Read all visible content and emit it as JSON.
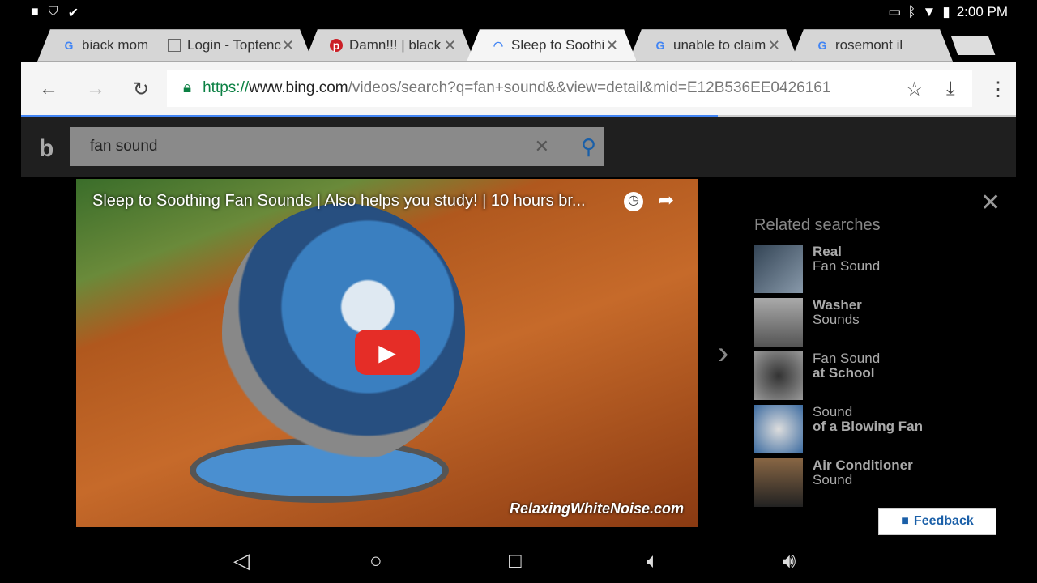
{
  "status": {
    "time": "2:00 PM"
  },
  "tabs": [
    {
      "title": "biack mom",
      "favicon": "google"
    },
    {
      "title": "Login - Toptenc",
      "favicon": "page"
    },
    {
      "title": "Damn!!! | black",
      "favicon": "pinterest"
    },
    {
      "title": "Sleep to Soothi",
      "favicon": "loading",
      "active": true
    },
    {
      "title": "unable to claim",
      "favicon": "google"
    },
    {
      "title": "rosemont il",
      "favicon": "google"
    }
  ],
  "url": {
    "scheme": "https://",
    "host": "www.bing.com",
    "path": "/videos/search?q=fan+sound&&view=detail&mid=E12B536EE0426161"
  },
  "load_progress": 0.7,
  "search": {
    "value": "fan sound"
  },
  "video": {
    "title": "Sleep to Soothing Fan Sounds | Also helps you study! | 10 hours br...",
    "watermark": "RelaxingWhiteNoise.com"
  },
  "related": {
    "heading": "Related searches",
    "items": [
      {
        "line1": "Real",
        "line2": "Fan Sound",
        "bold": 1
      },
      {
        "line1": "Washer",
        "line2": "Sounds",
        "bold": 1
      },
      {
        "line1": "Fan Sound",
        "line2": "at School",
        "bold": 2
      },
      {
        "line1": "Sound",
        "line2": "of a Blowing Fan",
        "bold": 2
      },
      {
        "line1": "Air Conditioner",
        "line2": "Sound",
        "bold": 1
      }
    ]
  },
  "feedback": "Feedback"
}
